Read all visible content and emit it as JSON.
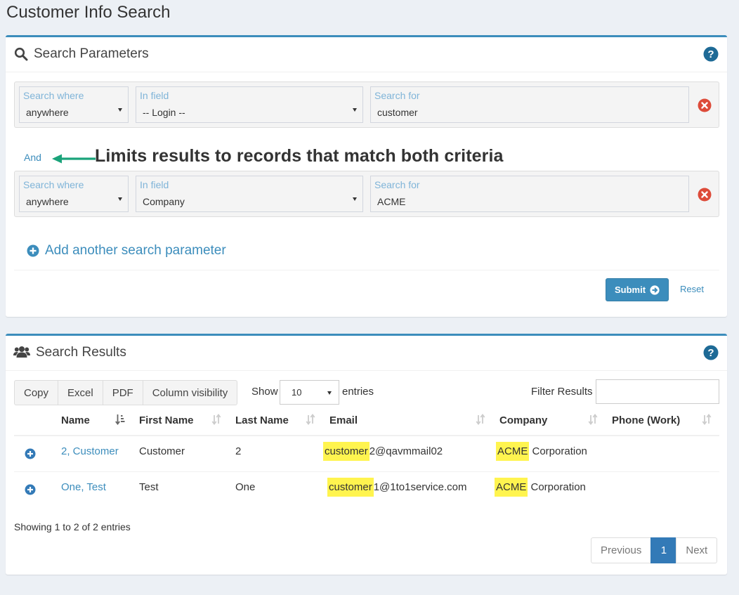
{
  "page_title": "Customer Info Search",
  "params_panel": {
    "title": "Search Parameters",
    "rows": [
      {
        "where_label": "Search where",
        "where_value": "anywhere",
        "field_label": "In field",
        "field_value": "-- Login --",
        "for_label": "Search for",
        "for_value": "customer"
      },
      {
        "where_label": "Search where",
        "where_value": "anywhere",
        "field_label": "In field",
        "field_value": "Company",
        "for_label": "Search for",
        "for_value": "ACME"
      }
    ],
    "and_label": "And",
    "annotation": "Limits results to records that match both criteria",
    "add_label": "Add another search parameter",
    "submit_label": "Submit",
    "reset_label": "Reset"
  },
  "results_panel": {
    "title": "Search Results",
    "buttons": [
      "Copy",
      "Excel",
      "PDF",
      "Column visibility"
    ],
    "show_label": "Show",
    "length_value": "10",
    "entries_label": "entries",
    "filter_label": "Filter Results",
    "columns": [
      "Name",
      "First Name",
      "Last Name",
      "Email",
      "Company",
      "Phone (Work)"
    ],
    "rows": [
      {
        "name": "2, Customer",
        "first": "Customer",
        "last": "2",
        "email_hl": "customer",
        "email_rest": "2@qavmmail02",
        "company_hl": "ACME",
        "company_rest": " Corporation",
        "phone": ""
      },
      {
        "name": "One, Test",
        "first": "Test",
        "last": "One",
        "email_hl": "customer",
        "email_rest": "1@1to1service.com",
        "company_hl": "ACME",
        "company_rest": " Corporation",
        "phone": ""
      }
    ],
    "info": "Showing 1 to 2 of 2 entries",
    "pagination": {
      "previous": "Previous",
      "current": "1",
      "next": "Next"
    }
  },
  "colors": {
    "accent": "#3c8dbc",
    "danger": "#dd4b39",
    "highlight": "#fff44f",
    "annotation_arrow": "#1aa37a"
  }
}
